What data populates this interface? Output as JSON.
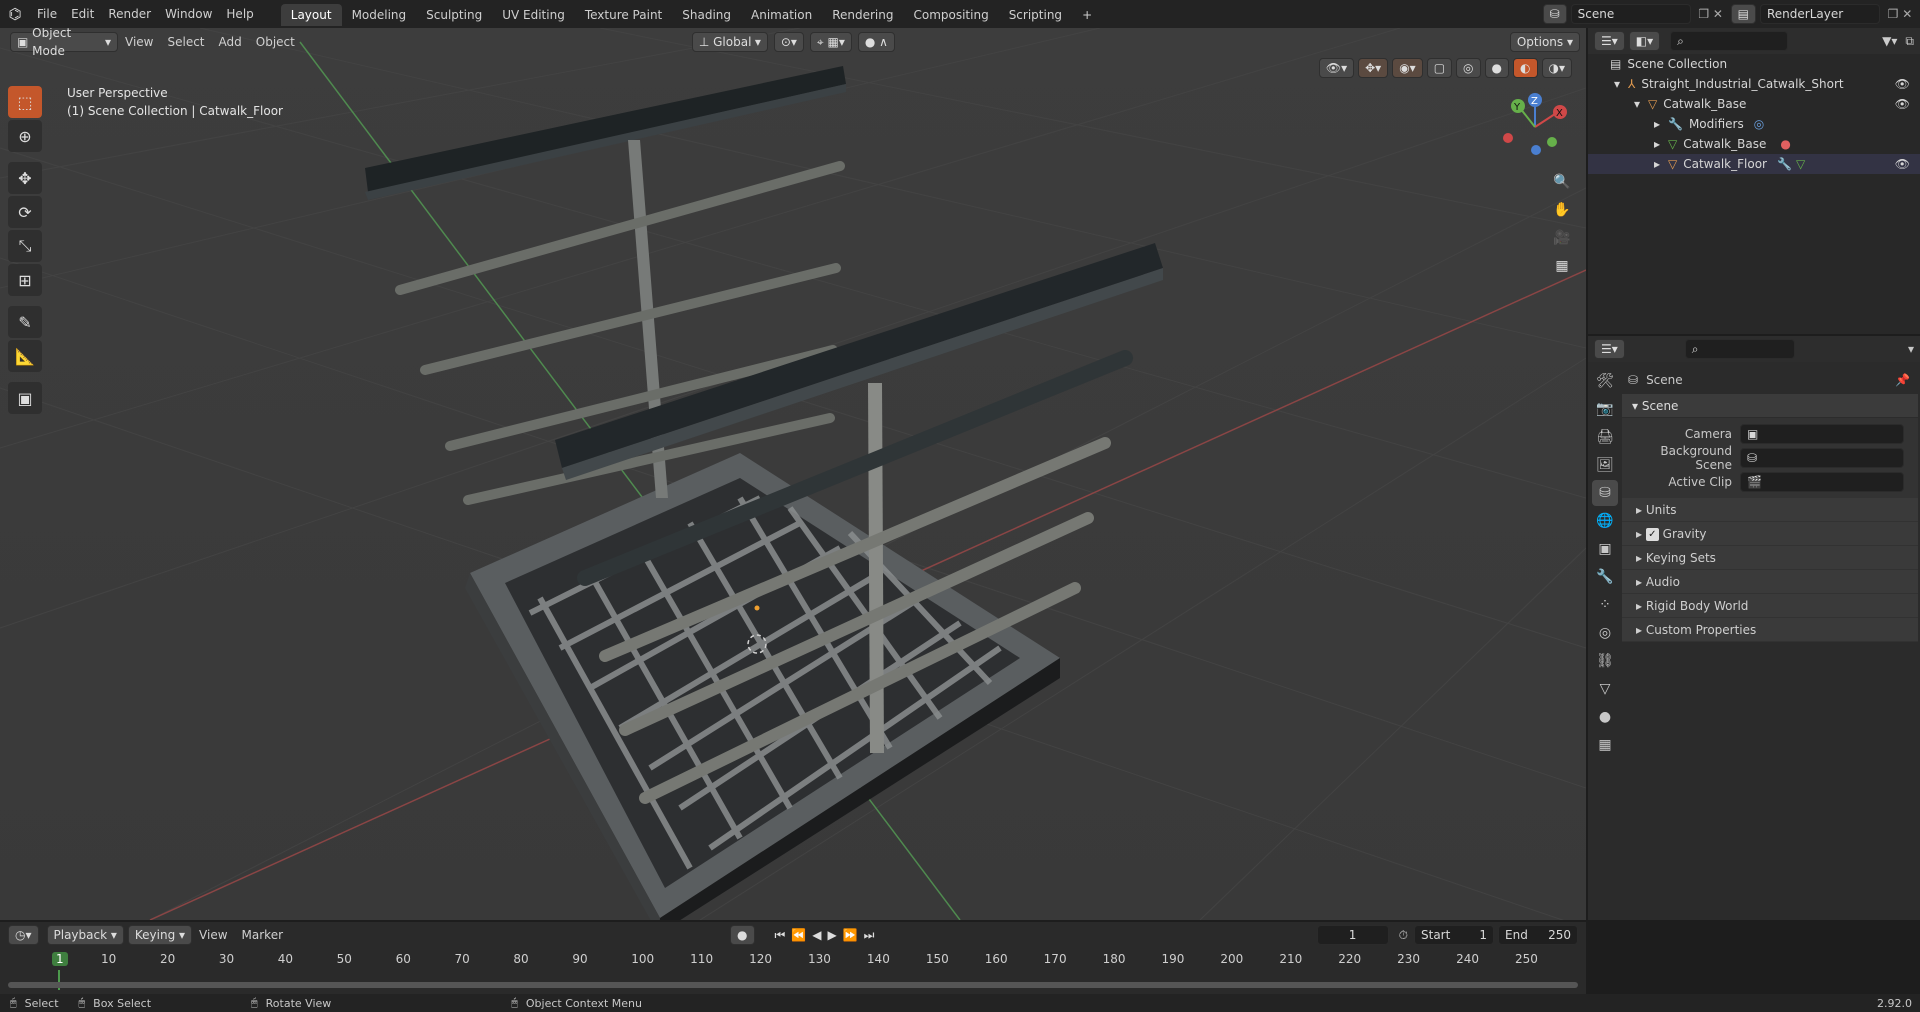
{
  "topbar": {
    "menus": [
      "File",
      "Edit",
      "Render",
      "Window",
      "Help"
    ],
    "workspaces": [
      "Layout",
      "Modeling",
      "Sculpting",
      "UV Editing",
      "Texture Paint",
      "Shading",
      "Animation",
      "Rendering",
      "Compositing",
      "Scripting"
    ],
    "active_workspace": "Layout",
    "add_tab": "+",
    "scene_name": "Scene",
    "view_layer": "RenderLayer"
  },
  "viewport": {
    "mode": "Object Mode",
    "menus": [
      "View",
      "Select",
      "Add",
      "Object"
    ],
    "orientation": "Global",
    "options": "Options",
    "overlay_line1": "User Perspective",
    "overlay_line2": "(1) Scene Collection | Catwalk_Floor",
    "gizmo": {
      "x": "X",
      "y": "Y",
      "z": "Z"
    }
  },
  "outliner": {
    "root": "Scene Collection",
    "items": [
      {
        "label": "Straight_Industrial_Catwalk_Short",
        "depth": 1
      },
      {
        "label": "Catwalk_Base",
        "depth": 2
      },
      {
        "label": "Modifiers",
        "depth": 3
      },
      {
        "label": "Catwalk_Base",
        "depth": 3
      },
      {
        "label": "Catwalk_Floor",
        "depth": 3
      }
    ]
  },
  "properties": {
    "header": "Scene",
    "section": "Scene",
    "fields": [
      {
        "label": "Camera"
      },
      {
        "label": "Background Scene"
      },
      {
        "label": "Active Clip"
      }
    ],
    "subpanels": [
      "Units",
      "Gravity",
      "Keying Sets",
      "Audio",
      "Rigid Body World",
      "Custom Properties"
    ]
  },
  "timeline": {
    "menus": [
      "Playback",
      "Keying",
      "View",
      "Marker"
    ],
    "current_frame": "1",
    "start_label": "Start",
    "start": "1",
    "end_label": "End",
    "end": "250",
    "ruler": [
      "1",
      "10",
      "20",
      "30",
      "40",
      "50",
      "60",
      "70",
      "80",
      "90",
      "100",
      "110",
      "120",
      "130",
      "140",
      "150",
      "160",
      "170",
      "180",
      "190",
      "200",
      "210",
      "220",
      "230",
      "240",
      "250"
    ]
  },
  "status": {
    "select": "Select",
    "box_select": "Box Select",
    "rotate": "Rotate View",
    "context": "Object Context Menu",
    "version": "2.92.0"
  }
}
